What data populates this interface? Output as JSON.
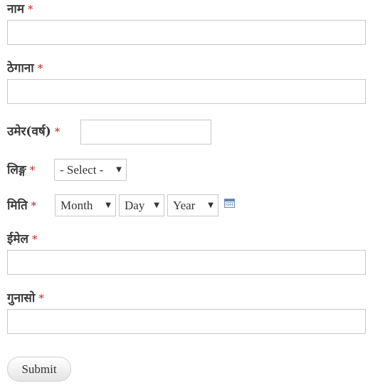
{
  "form": {
    "required_mark": "*",
    "fields": {
      "name": {
        "label": "नाम",
        "value": ""
      },
      "address": {
        "label": "ठेगाना",
        "value": ""
      },
      "age": {
        "label": "उमेर(वर्ष)",
        "value": ""
      },
      "gender": {
        "label": "लिङ्ग",
        "selected": "- Select -"
      },
      "date": {
        "label": "मिति",
        "month": "Month",
        "day": "Day",
        "year": "Year",
        "calendar_icon": "calendar-icon"
      },
      "email": {
        "label": "ईमेल",
        "value": ""
      },
      "complaint": {
        "label": "गुनासो",
        "value": ""
      }
    },
    "submit_label": "Submit"
  },
  "colors": {
    "required": "#cc2222",
    "border": "#c8c8c8",
    "calendar": "#5f86b5"
  }
}
